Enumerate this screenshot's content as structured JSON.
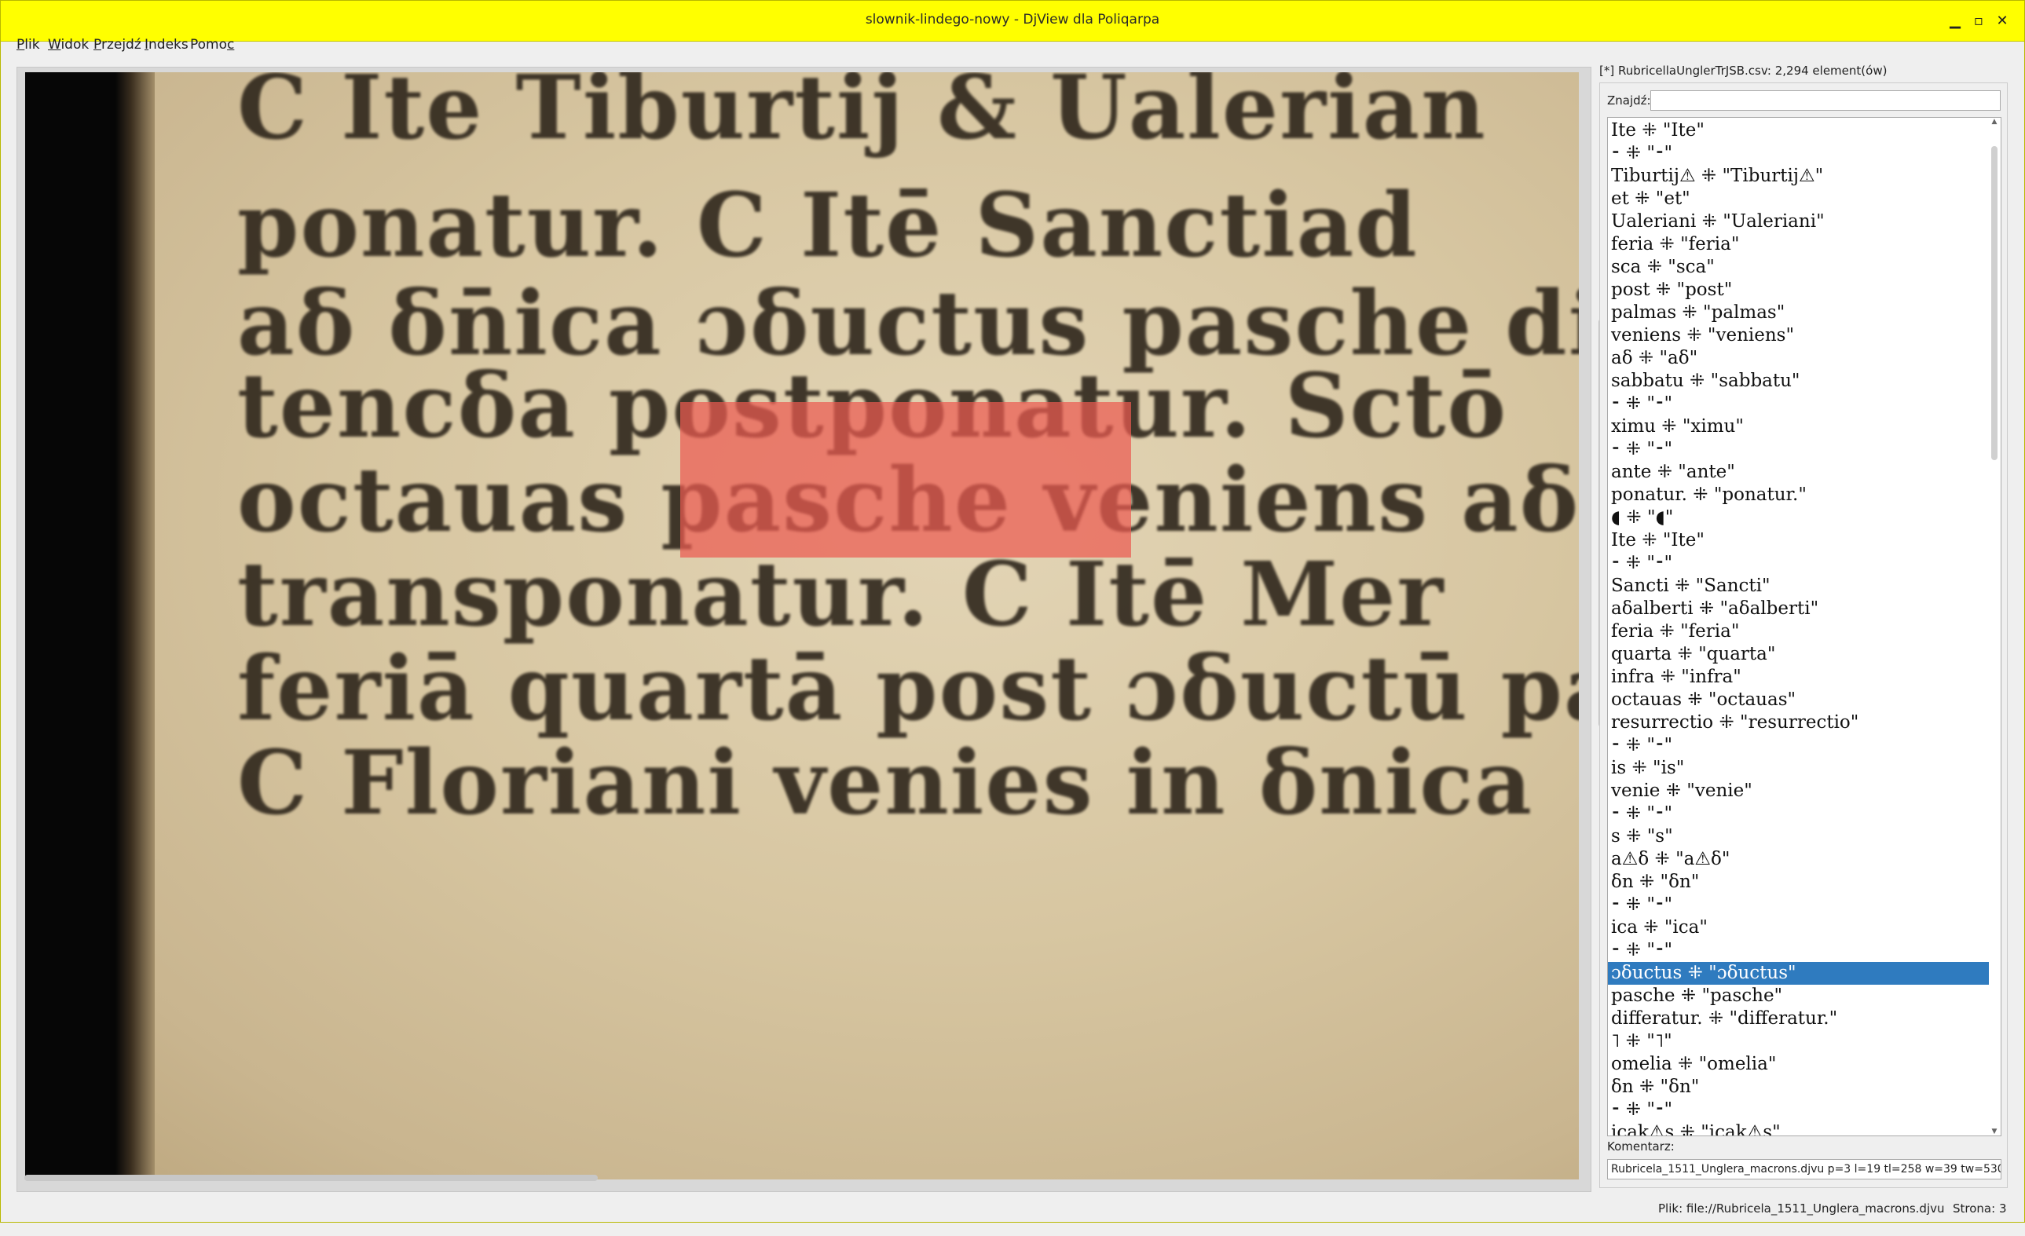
{
  "window": {
    "title": "slownik-lindego-nowy - DjView dla Poliqarpa",
    "minimize": "▁",
    "maximize": "▫",
    "close": "✕"
  },
  "menu": [
    {
      "pre": "",
      "ul": "P",
      "post": "lik"
    },
    {
      "pre": "",
      "ul": "W",
      "post": "idok"
    },
    {
      "pre": "",
      "ul": "P",
      "post": "rzejdź"
    },
    {
      "pre": "",
      "ul": "I",
      "post": "ndeks"
    },
    {
      "pre": "Pomo",
      "ul": "c",
      "post": ""
    }
  ],
  "scan": {
    "lines": [
      "C Ite Tiburtij & Ualerian",
      "ponatur. C Itē Sanctiad",
      "aδ δn̄ica ɔδuctus pasche di",
      "tencδa postponatur. Sctō",
      "octauas pasche veniens aδ",
      "transponatur. C Itē Mer",
      "feriā quartā post ɔδuctū pa",
      "C Floriani venies in δnica"
    ]
  },
  "panel": {
    "header": "[*] RubricellaUnglerTrJSB.csv: 2,294 element(ów)",
    "find_label": "Znajdź:",
    "find_value": "",
    "comment_label": "Komentarz:",
    "comment_value": "Rubricela_1511_Unglera_macrons.djvu p=3 l=19 tl=258 w=39 tw=530",
    "list": [
      "Ite  ⁜ \"Ite\"",
      "⁃ ⁜ \"⁃\"",
      "Tiburtij⚠  ⁜ \"Tiburtij⚠\"",
      "et  ⁜ \"et\"",
      "Ualeriani  ⁜ \"Ualeriani\"",
      "feria  ⁜ \"feria\"",
      "sca  ⁜ \"sca\"",
      "post  ⁜ \"post\"",
      "palmas  ⁜ \"palmas\"",
      "veniens  ⁜ \"veniens\"",
      "aδ  ⁜ \"aδ\"",
      "sabbatu  ⁜ \"sabbatu\"",
      "⁃ ⁜ \"⁃\"",
      "ximu  ⁜ \"ximu\"",
      "⁃ ⁜ \"⁃\"",
      "ante  ⁜ \"ante\"",
      "ponatur.  ⁜ \"ponatur.\"",
      "◖  ⁜ \"◖\"",
      "Ite  ⁜ \"Ite\"",
      "⁃ ⁜ \"⁃\"",
      "Sancti  ⁜ \"Sancti\"",
      "aδalberti  ⁜ \"aδalberti\"",
      "feria  ⁜ \"feria\"",
      "quarta  ⁜ \"quarta\"",
      "infra  ⁜ \"infra\"",
      "octauas  ⁜ \"octauas\"",
      "resurrectio  ⁜ \"resurrectio\"",
      "⁃ ⁜ \"⁃\"",
      "is  ⁜ \"is\"",
      "venie  ⁜ \"venie\"",
      "⁃ ⁜ \"⁃\"",
      "s  ⁜ \"s\"",
      "a⚠δ  ⁜ \"a⚠δ\"",
      "δn  ⁜ \"δn\"",
      "⁃ ⁜ \"⁃\"",
      "ica  ⁜ \"ica\"",
      "⁃ ⁜ \"⁃\"",
      "ɔδuctus  ⁜ \"ɔδuctus\"",
      "pasche  ⁜ \"pasche\"",
      "differatur.  ⁜ \"differatur.\"",
      "˥  ⁜ \"˥\"",
      "omelia  ⁜ \"omelia\"",
      "δn  ⁜ \"δn\"",
      "⁃ ⁜ \"⁃\"",
      "icak⚠s  ⁜ \"icak⚠s\""
    ],
    "selected_index": 37
  },
  "status": {
    "file": "Plik: file://Rubricela_1511_Unglera_macrons.djvu",
    "page": "Strona: 3"
  }
}
